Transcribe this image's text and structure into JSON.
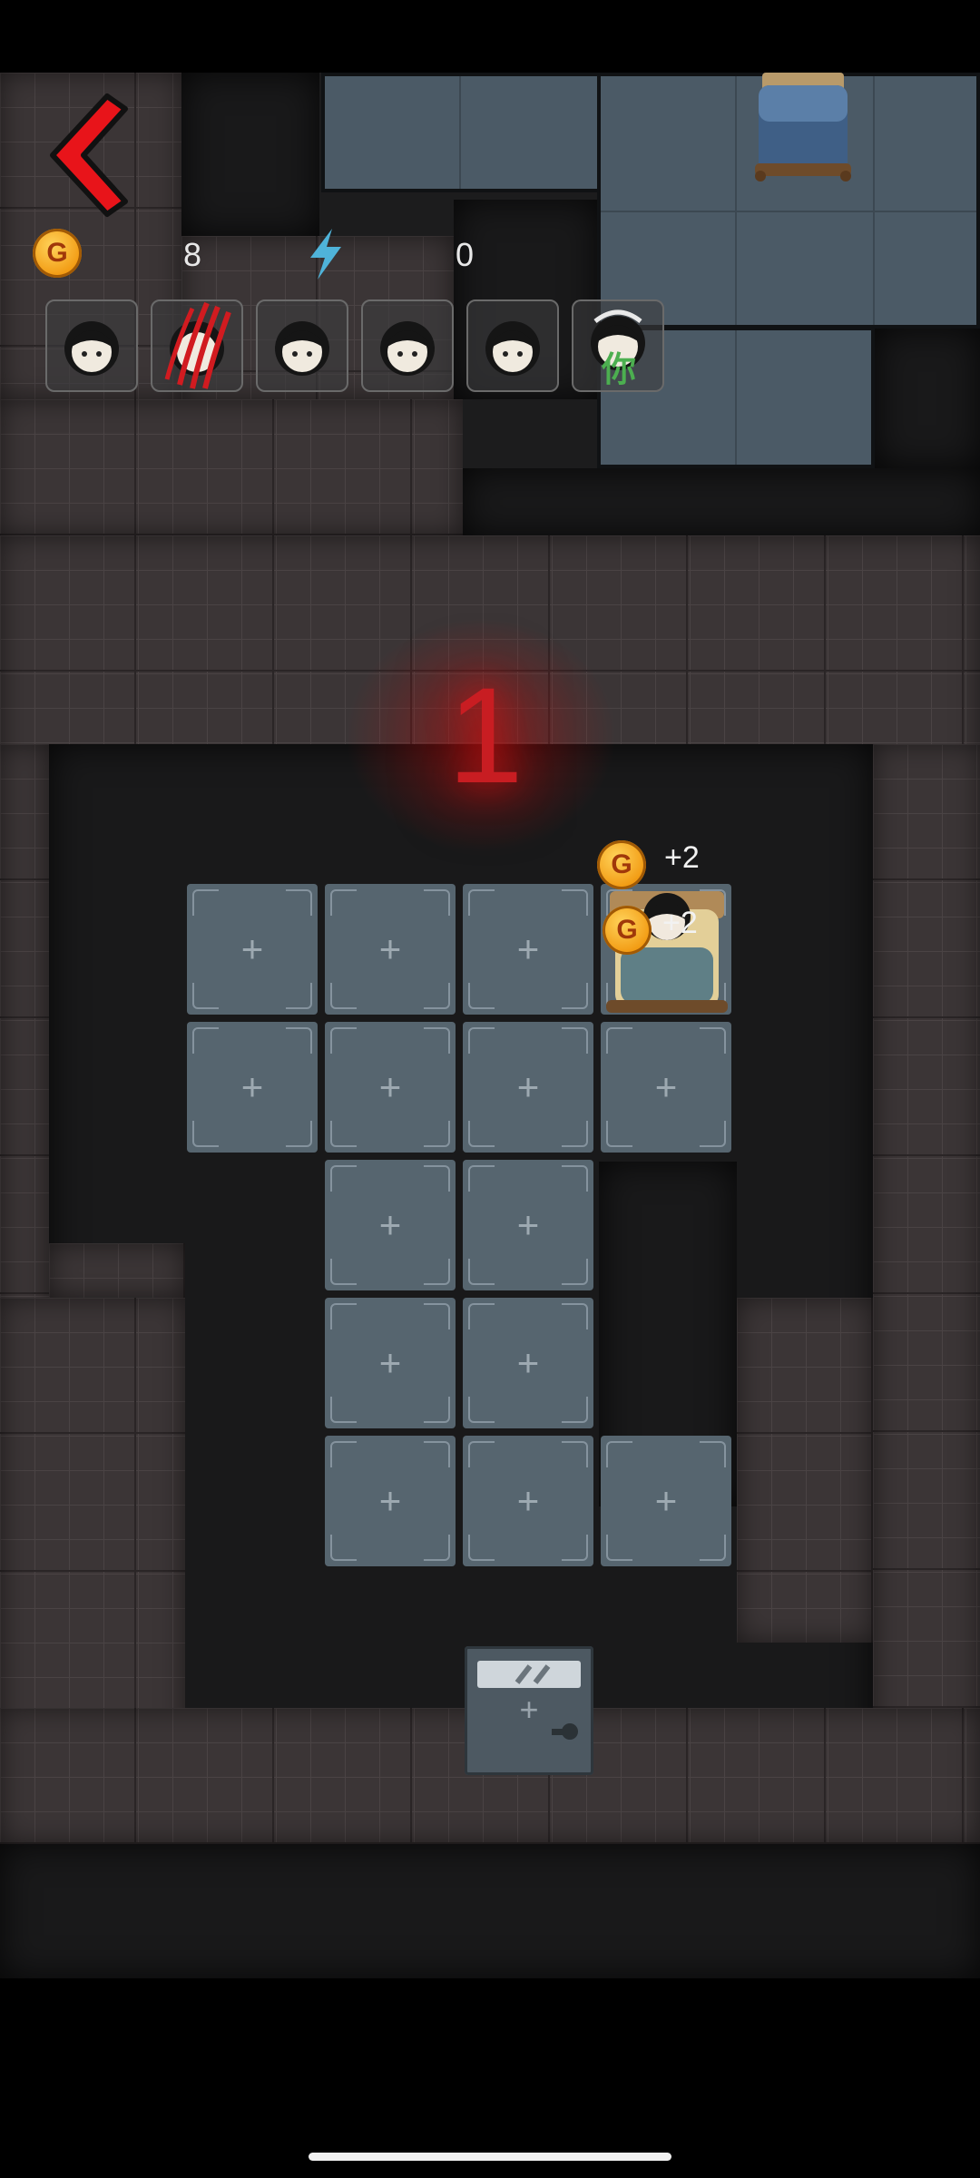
{
  "hud": {
    "gold_icon": "G",
    "gold_value": "8",
    "energy_icon": "lightning-icon",
    "energy_value": "0"
  },
  "avatars": [
    {
      "type": "ghost-girl-face"
    },
    {
      "type": "ghost-girl-claw"
    },
    {
      "type": "ghost-girl-face"
    },
    {
      "type": "ghost-girl-face"
    },
    {
      "type": "ghost-girl-face"
    },
    {
      "type": "player-you",
      "label": "你"
    }
  ],
  "countdown": "1",
  "rewards": [
    {
      "icon": "G",
      "text": "+2"
    },
    {
      "icon": "G",
      "text": "+2"
    }
  ],
  "tile_plus": "+",
  "colors": {
    "accent_red": "#d0101a",
    "coin": "#f5a623",
    "energy": "#4fb3d9",
    "player_green": "#4caf50"
  }
}
